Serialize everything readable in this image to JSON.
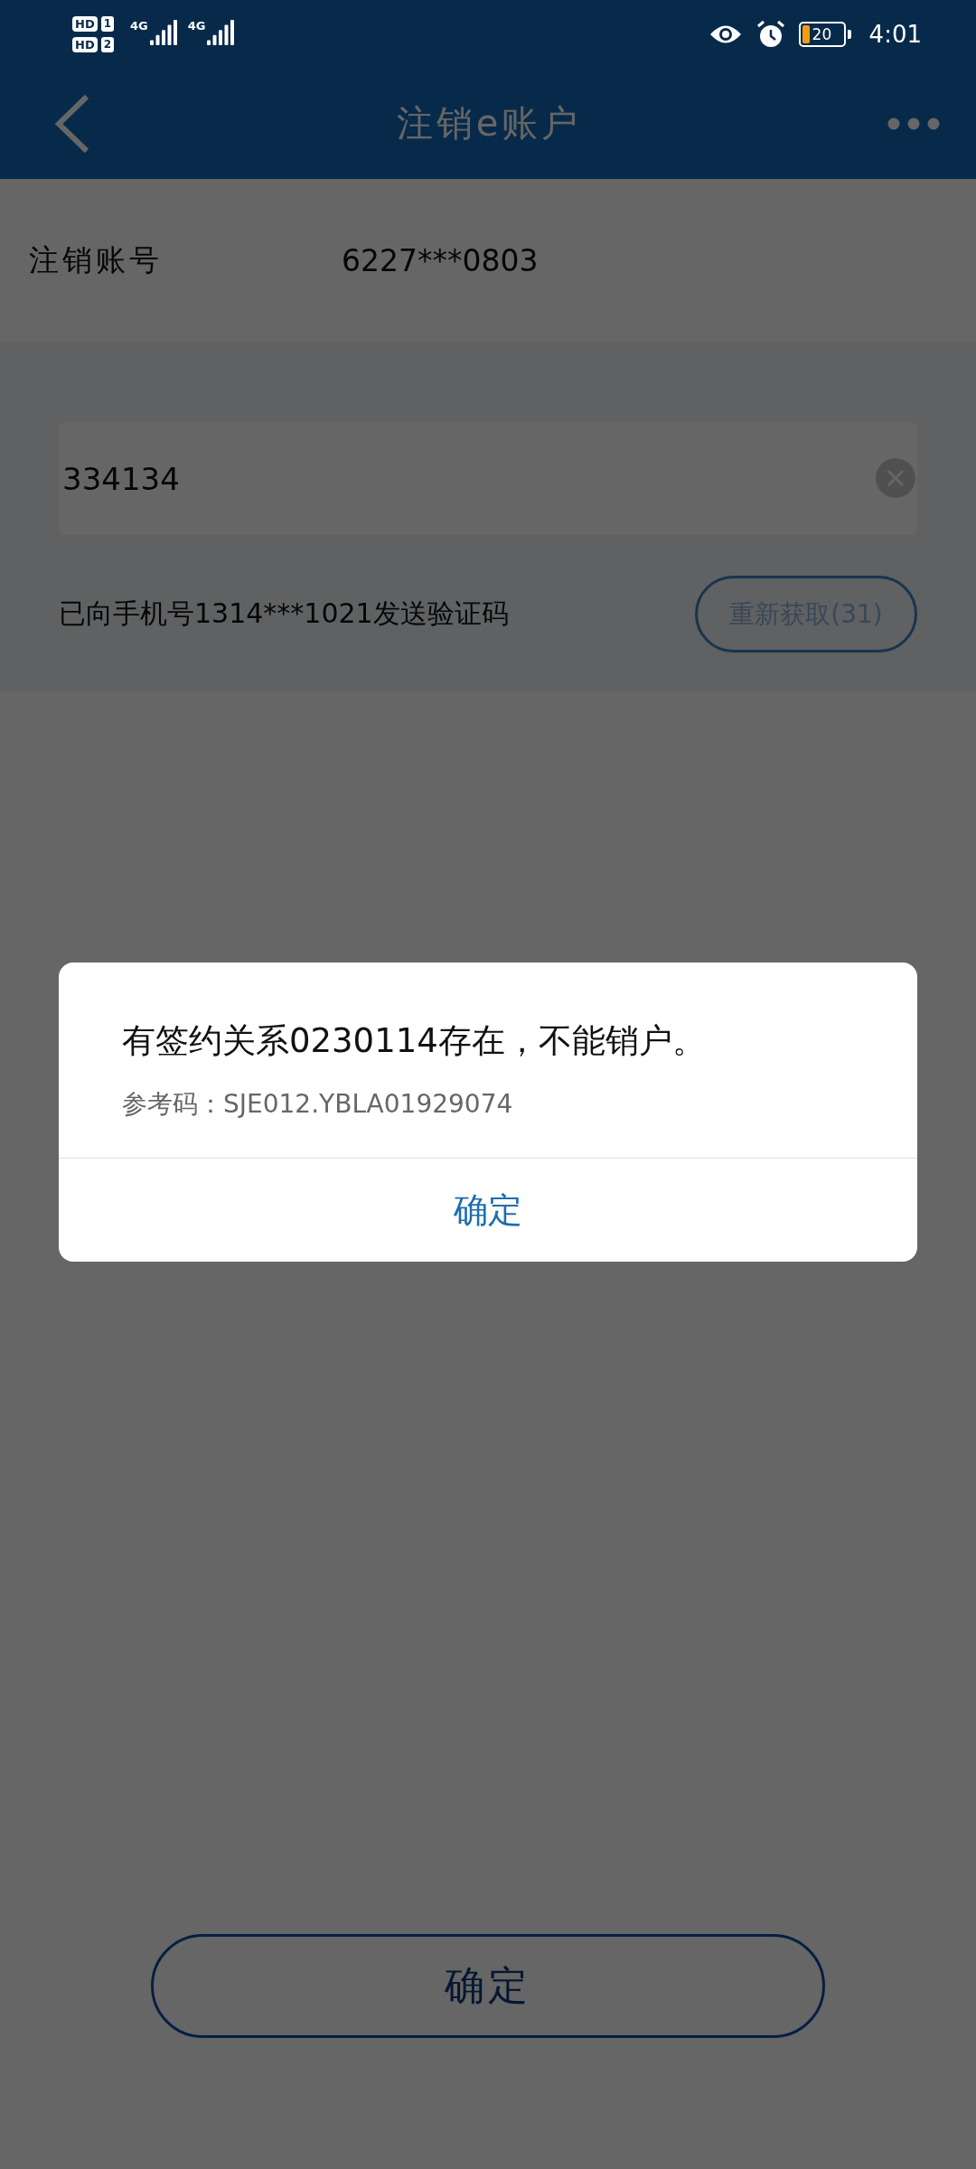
{
  "status_bar": {
    "sim_badges": [
      {
        "label": "HD",
        "slot": "1"
      },
      {
        "label": "HD",
        "slot": "2"
      }
    ],
    "networks": [
      "4G",
      "4G"
    ],
    "battery_text": "20",
    "time": "4:01"
  },
  "header": {
    "title": "注销e账户"
  },
  "account": {
    "label": "注销账号",
    "value": "6227***0803"
  },
  "code_field": {
    "value": "334134"
  },
  "sms_notice": "已向手机号1314***1021发送验证码",
  "resend_button": {
    "label": "重新获取(31)",
    "disabled": true
  },
  "submit_button": {
    "label": "确定"
  },
  "dialog": {
    "message": "有签约关系0230114存在，不能销户。",
    "reference": "参考码：SJE012.YBLA01929074",
    "button": "确定"
  }
}
